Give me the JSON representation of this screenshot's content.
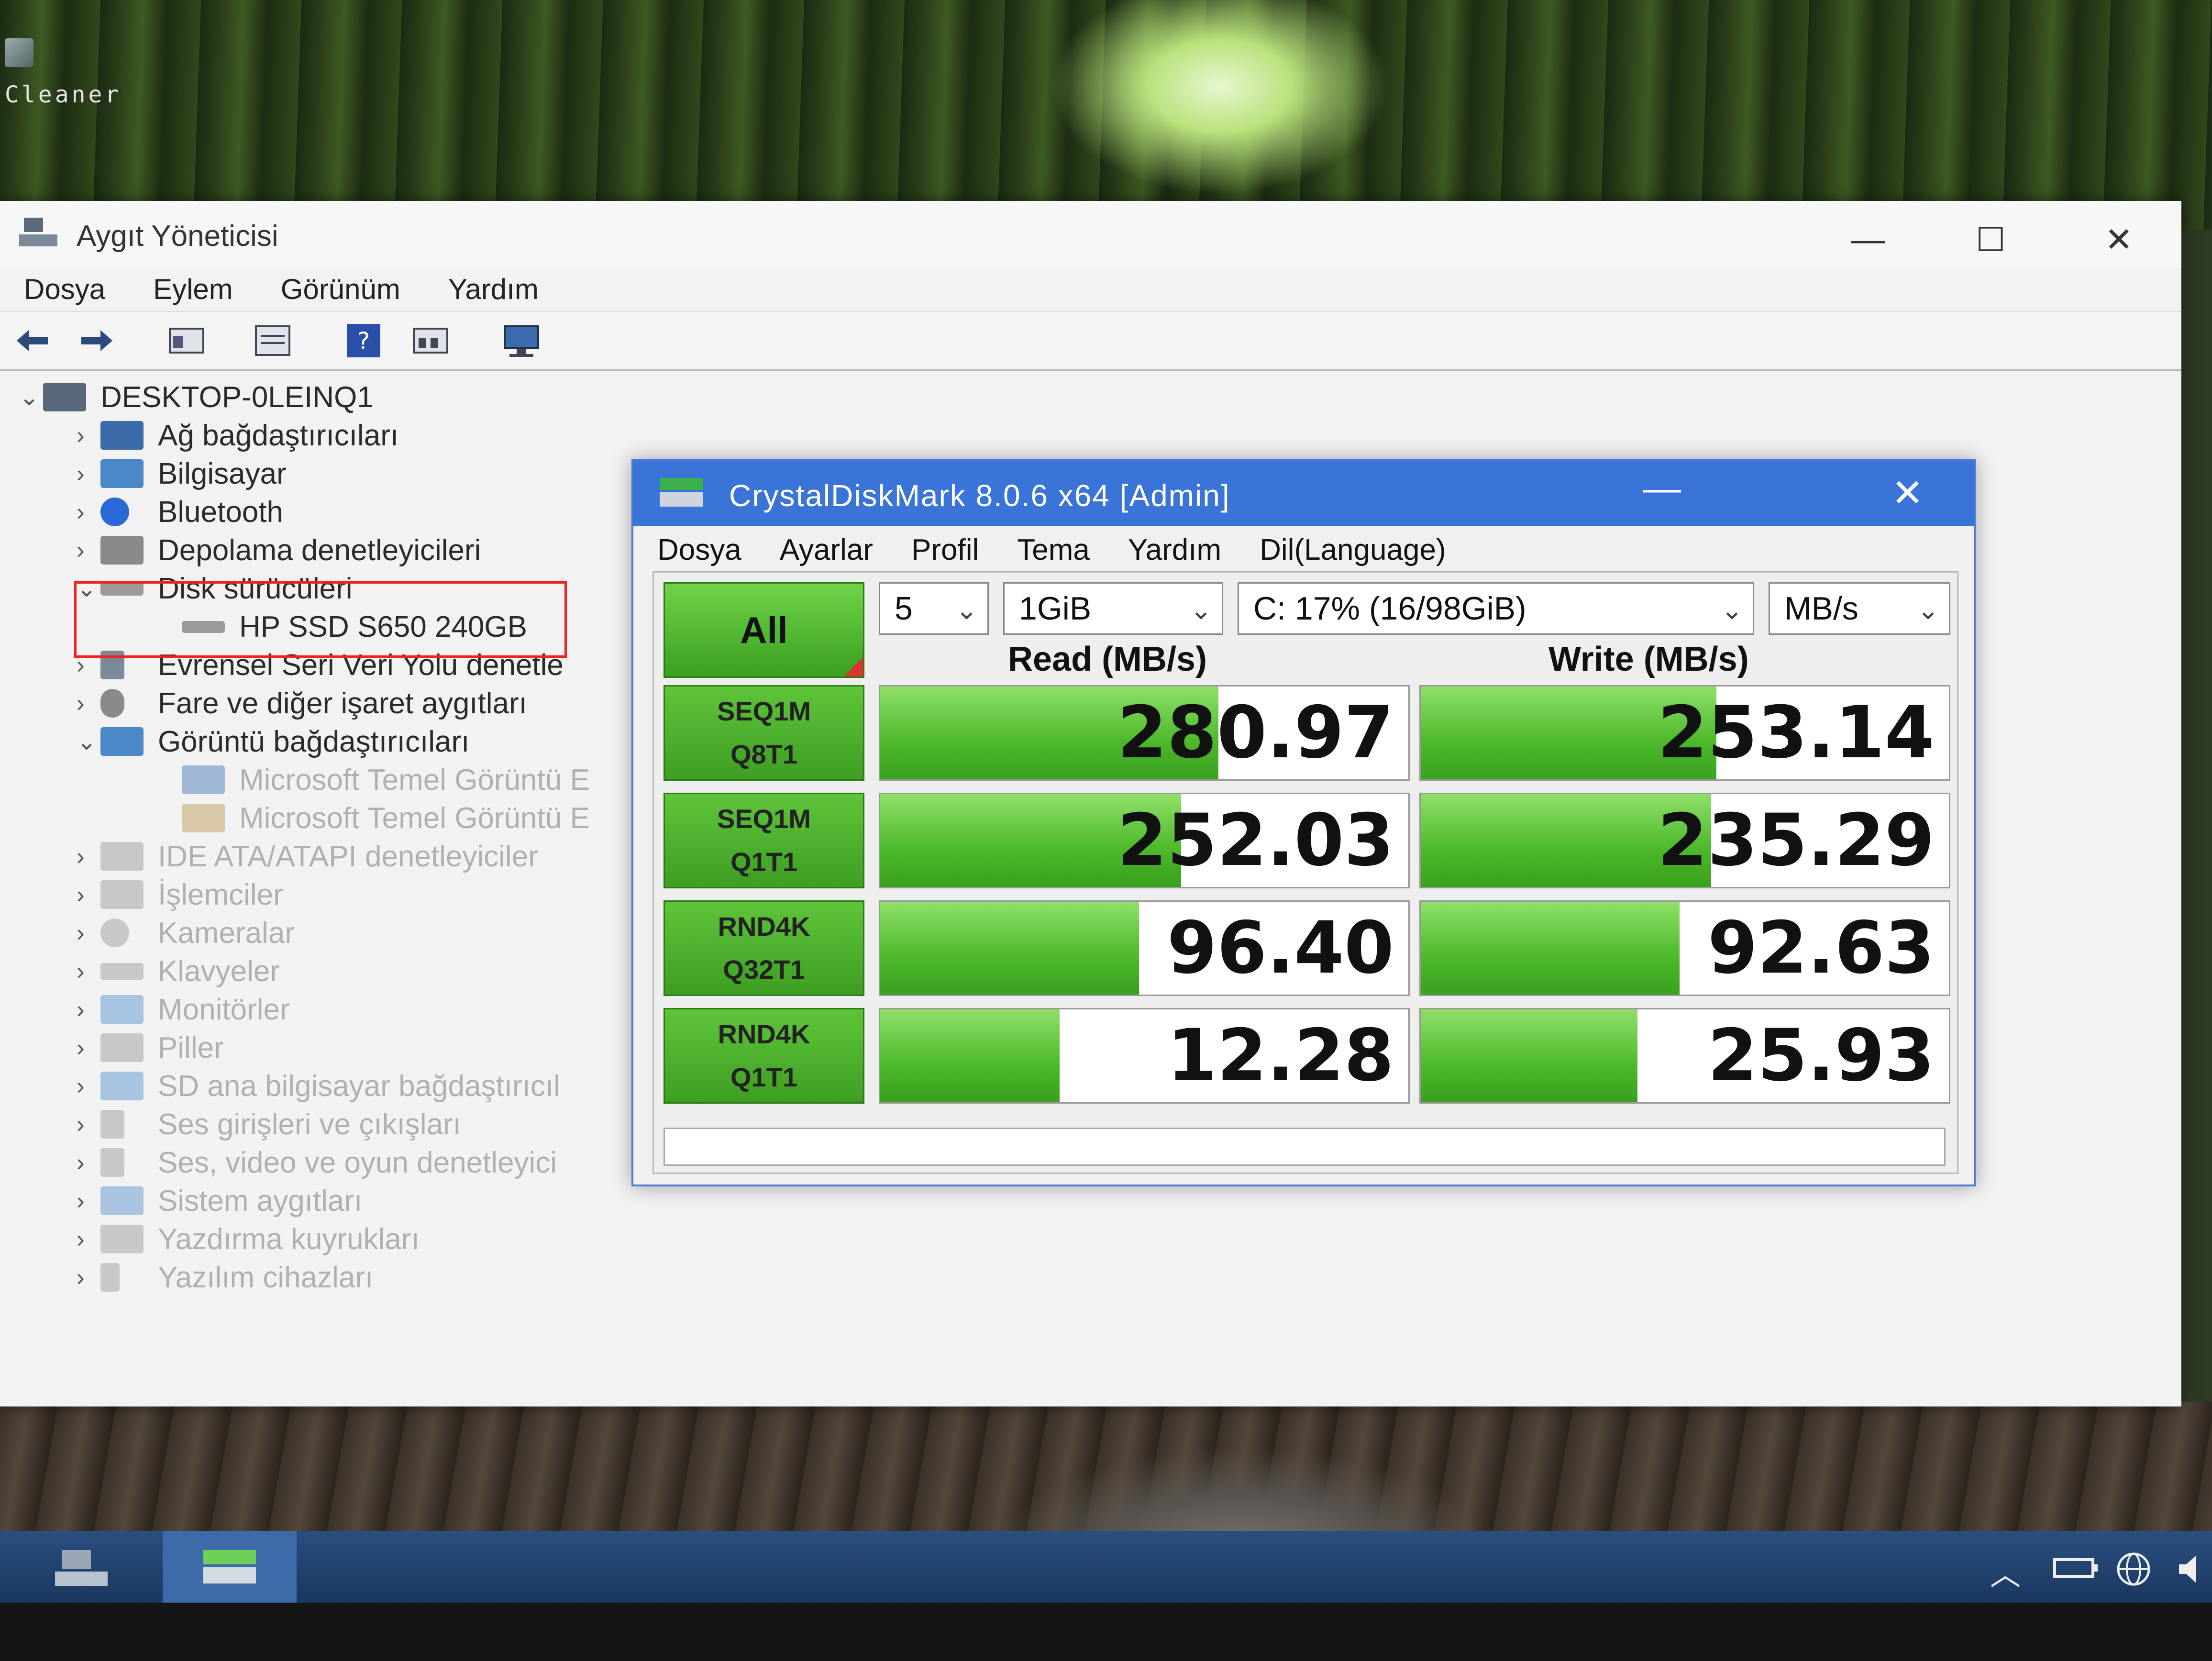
{
  "desktop": {
    "icon_label": "Cleaner"
  },
  "device_manager": {
    "title": "Aygıt Yöneticisi",
    "menu": [
      "Dosya",
      "Eylem",
      "Görünüm",
      "Yardım"
    ],
    "controls": {
      "minimize": "—",
      "maximize": "☐",
      "close": "✕"
    },
    "tree": [
      {
        "label": "DESKTOP-0LEINQ1",
        "chev": "⌄",
        "state": "normal"
      },
      {
        "label": "Ağ bağdaştırıcıları",
        "chev": "›",
        "state": "normal"
      },
      {
        "label": "Bilgisayar",
        "chev": "›",
        "state": "normal"
      },
      {
        "label": "Bluetooth",
        "chev": "›",
        "state": "normal"
      },
      {
        "label": "Depolama denetleyicileri",
        "chev": "›",
        "state": "normal"
      },
      {
        "label": "Disk sürücüleri",
        "chev": "⌄",
        "state": "normal"
      },
      {
        "label": "HP SSD S650 240GB",
        "chev": "",
        "state": "normal"
      },
      {
        "label": "Evrensel Seri Veri Yolu denetle",
        "chev": "›",
        "state": "normal"
      },
      {
        "label": "Fare ve diğer işaret aygıtları",
        "chev": "›",
        "state": "normal"
      },
      {
        "label": "Görüntü bağdaştırıcıları",
        "chev": "⌄",
        "state": "normal"
      },
      {
        "label": "Microsoft Temel Görüntü E",
        "chev": "",
        "state": "dim"
      },
      {
        "label": "Microsoft Temel Görüntü E",
        "chev": "",
        "state": "dim"
      },
      {
        "label": "IDE ATA/ATAPI denetleyiciler",
        "chev": "›",
        "state": "dim"
      },
      {
        "label": "İşlemciler",
        "chev": "›",
        "state": "dim"
      },
      {
        "label": "Kameralar",
        "chev": "›",
        "state": "dim"
      },
      {
        "label": "Klavyeler",
        "chev": "›",
        "state": "dim"
      },
      {
        "label": "Monitörler",
        "chev": "›",
        "state": "dim"
      },
      {
        "label": "Piller",
        "chev": "›",
        "state": "dim"
      },
      {
        "label": "SD ana bilgisayar bağdaştırıcıl",
        "chev": "›",
        "state": "dim"
      },
      {
        "label": "Ses girişleri ve çıkışları",
        "chev": "›",
        "state": "dim"
      },
      {
        "label": "Ses, video ve oyun denetleyici",
        "chev": "›",
        "state": "dim"
      },
      {
        "label": "Sistem aygıtları",
        "chev": "›",
        "state": "dim"
      },
      {
        "label": "Yazdırma kuyrukları",
        "chev": "›",
        "state": "dim"
      },
      {
        "label": "Yazılım cihazları",
        "chev": "›",
        "state": "dim"
      }
    ]
  },
  "cdm": {
    "title": "CrystalDiskMark 8.0.6 x64 [Admin]",
    "controls": {
      "minimize": "—",
      "close": "✕"
    },
    "menu": [
      "Dosya",
      "Ayarlar",
      "Profil",
      "Tema",
      "Yardım",
      "Dil(Language)"
    ],
    "all_label": "All",
    "count": "5",
    "size": "1GiB",
    "drive": "C: 17% (16/98GiB)",
    "unit": "MB/s",
    "read_header": "Read (MB/s)",
    "write_header": "Write (MB/s)",
    "tests": [
      {
        "line1": "SEQ1M",
        "line2": "Q8T1",
        "read": "280.97",
        "write": "253.14",
        "read_fill": 0.64,
        "write_fill": 0.56
      },
      {
        "line1": "SEQ1M",
        "line2": "Q1T1",
        "read": "252.03",
        "write": "235.29",
        "read_fill": 0.57,
        "write_fill": 0.55
      },
      {
        "line1": "RND4K",
        "line2": "Q32T1",
        "read": "96.40",
        "write": "92.63",
        "read_fill": 0.49,
        "write_fill": 0.49
      },
      {
        "line1": "RND4K",
        "line2": "Q1T1",
        "read": "12.28",
        "write": "25.93",
        "read_fill": 0.34,
        "write_fill": 0.41
      }
    ]
  },
  "colors": {
    "accent": "#3a74d8",
    "bar_green": "#4cb82a",
    "highlight": "#e22222"
  }
}
